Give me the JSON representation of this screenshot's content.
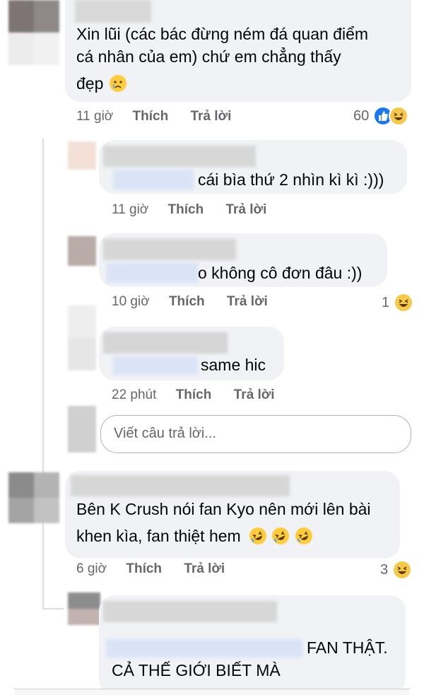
{
  "comments": [
    {
      "text_lines": [
        "Xin lũi (các bác đừng ném đá  quan điểm",
        "cá nhân của em)  chứ em chẳng thấy",
        "đẹp"
      ],
      "time": "11 giờ",
      "like": "Thích",
      "reply": "Trả lời",
      "reaction_count": "60"
    },
    {
      "text_lines": [
        "cái bìa thứ 2 nhìn kì kì :)))"
      ],
      "time": "11 giờ",
      "like": "Thích",
      "reply": "Trả lời"
    },
    {
      "text_lines": [
        "o không cô đơn đâu :))"
      ],
      "time": "10 giờ",
      "like": "Thích",
      "reply": "Trả lời",
      "reaction_count": "1"
    },
    {
      "text_lines": [
        "same hic"
      ],
      "time": "22 phút",
      "like": "Thích",
      "reply": "Trả lời"
    },
    {
      "text_lines": [
        "Bên K Crush nói fan Kyo nên mới lên bài",
        "khen kìa, fan thiệt hem"
      ],
      "time": "6 giờ",
      "like": "Thích",
      "reply": "Trả lời",
      "reaction_count": "3"
    },
    {
      "text_lines": [
        "FAN THẬT.",
        "CẢ THẾ GIỚI BIẾT MÀ"
      ]
    }
  ],
  "reply_input": {
    "placeholder": "Viết câu trả lời..."
  },
  "colors": {
    "bubble": "#f0f2f5",
    "meta_text": "#65676b",
    "like_blue": "#1877f2",
    "haha_yellow": "#f7c94a"
  },
  "icons": [
    "crying-face-emoji",
    "like-reaction-icon",
    "haha-reaction-icon",
    "rolling-laughing-emoji"
  ]
}
